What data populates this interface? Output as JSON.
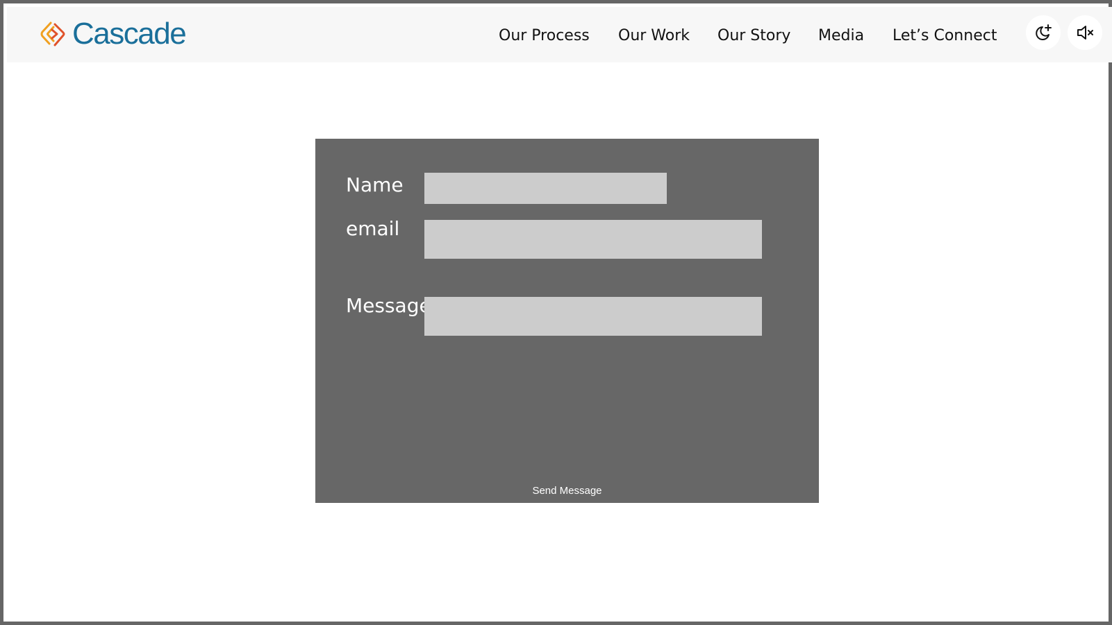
{
  "header": {
    "logo": {
      "text": "Cascade",
      "icon": "cascade-logo-icon",
      "colors": {
        "text": "#1a6f9a",
        "mark_primary": "#f0a020",
        "mark_secondary": "#e0522a"
      }
    },
    "nav": [
      {
        "label": "Our Process"
      },
      {
        "label": "Our Work"
      },
      {
        "label": "Our Story"
      },
      {
        "label": "Media"
      },
      {
        "label": "Let’s Connect"
      }
    ],
    "theme_toggle": {
      "icon": "moon-sparkle-icon"
    },
    "mute_toggle": {
      "icon": "speaker-muted-icon"
    }
  },
  "contact_form": {
    "background": "#676767",
    "field_color": "#cccccc",
    "name_label": "Name",
    "name_value": "",
    "email_label": "email",
    "email_value": "",
    "message_label": "Message",
    "message_value": "",
    "submit_label": "Send Message"
  }
}
